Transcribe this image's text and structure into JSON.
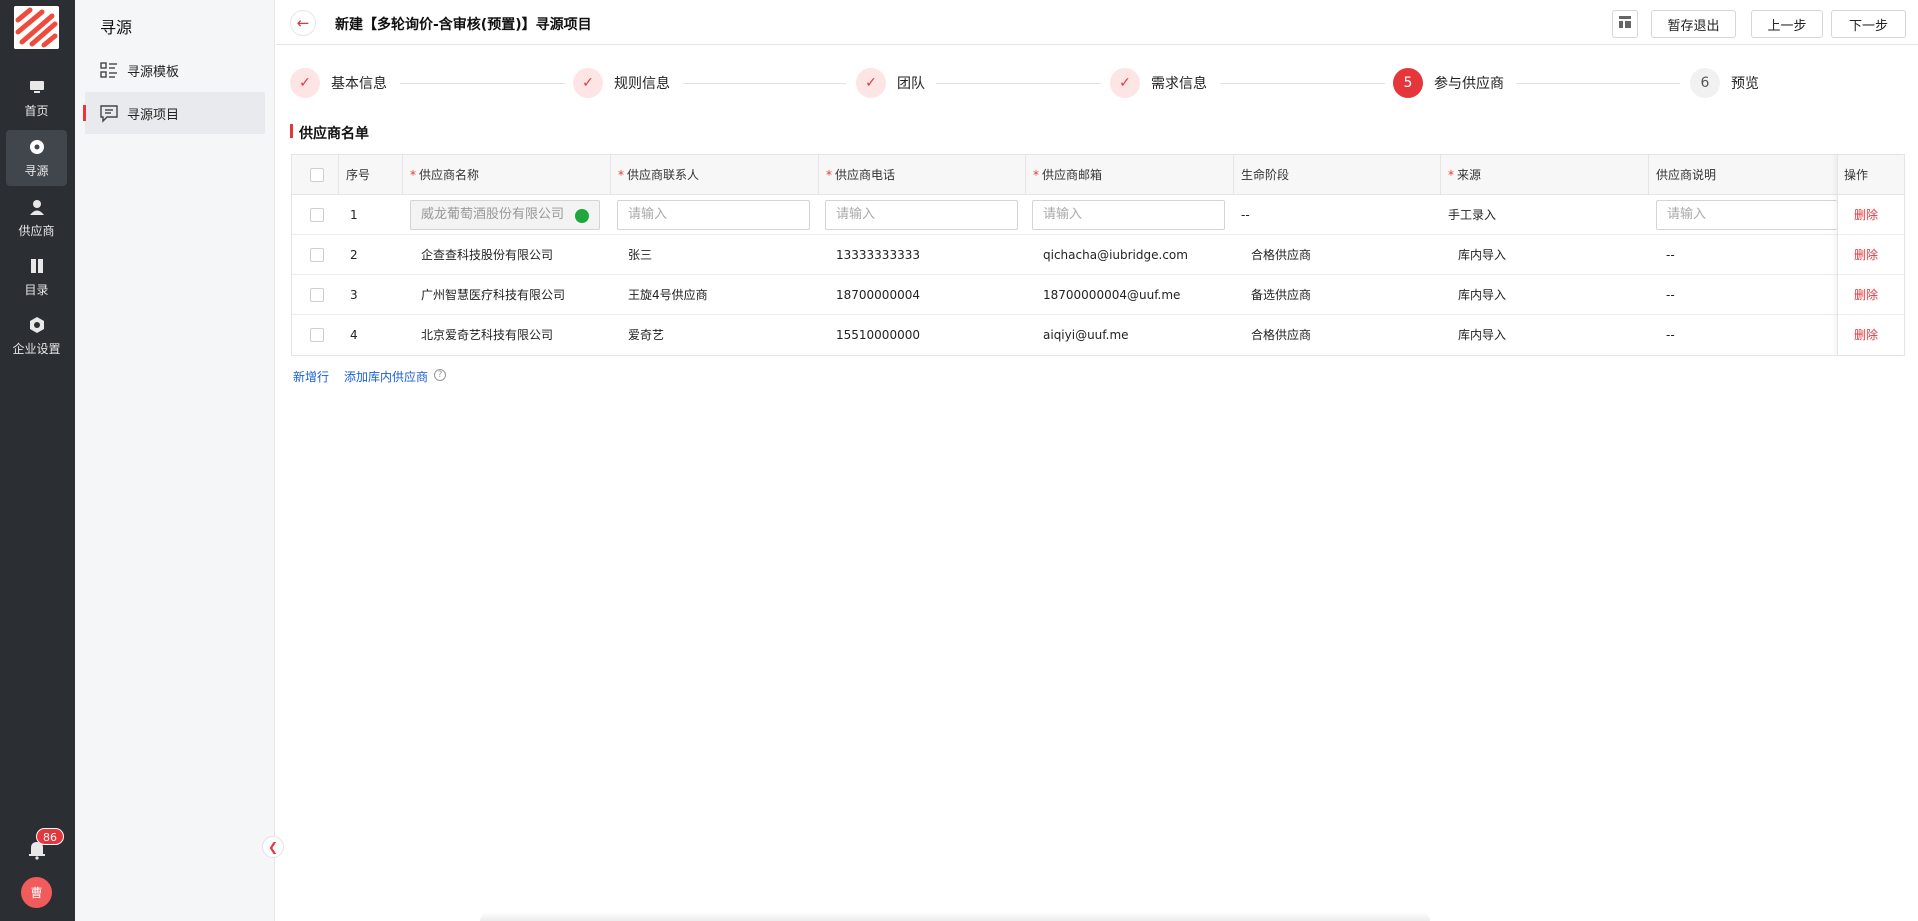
{
  "rail": {
    "items": [
      {
        "label": "首页",
        "icon": "monitor-icon"
      },
      {
        "label": "寻源",
        "icon": "compass-icon"
      },
      {
        "label": "供应商",
        "icon": "user-icon"
      },
      {
        "label": "目录",
        "icon": "book-icon"
      },
      {
        "label": "企业设置",
        "icon": "gear-icon"
      }
    ],
    "notification_count": "86",
    "avatar_text": "曹"
  },
  "sidebar": {
    "title": "寻源",
    "items": [
      {
        "label": "寻源模板",
        "icon": "template-list-icon"
      },
      {
        "label": "寻源项目",
        "icon": "chat-list-icon"
      }
    ]
  },
  "header": {
    "title": "新建【多轮询价-含审核(预置)】寻源项目",
    "save_exit": "暂存退出",
    "prev": "上一步",
    "next": "下一步"
  },
  "steps": [
    {
      "label": "基本信息",
      "status": "done",
      "num": ""
    },
    {
      "label": "规则信息",
      "status": "done",
      "num": ""
    },
    {
      "label": "团队",
      "status": "done",
      "num": ""
    },
    {
      "label": "需求信息",
      "status": "done",
      "num": ""
    },
    {
      "label": "参与供应商",
      "status": "current",
      "num": "5"
    },
    {
      "label": "预览",
      "status": "todo",
      "num": "6"
    }
  ],
  "section": {
    "title": "供应商名单"
  },
  "table": {
    "columns": [
      "序号",
      "供应商名称",
      "供应商联系人",
      "供应商电话",
      "供应商邮箱",
      "生命阶段",
      "来源",
      "供应商说明",
      "操作"
    ],
    "placeholder": "请输入",
    "rows": [
      {
        "index": "1",
        "name": "威龙葡萄酒股份有限公司",
        "contact": "",
        "phone": "",
        "email": "",
        "stage": "--",
        "source": "手工录入",
        "note": "",
        "action": "删除"
      },
      {
        "index": "2",
        "name": "企查查科技股份有限公司",
        "contact": "张三",
        "phone": "13333333333",
        "email": "qichacha@iubridge.com",
        "stage": "合格供应商",
        "source": "库内导入",
        "note": "--",
        "action": "删除"
      },
      {
        "index": "3",
        "name": "广州智慧医疗科技有限公司",
        "contact": "王旋4号供应商",
        "phone": "18700000004",
        "email": "18700000004@uuf.me",
        "stage": "备选供应商",
        "source": "库内导入",
        "note": "--",
        "action": "删除"
      },
      {
        "index": "4",
        "name": "北京爱奇艺科技有限公司",
        "contact": "爱奇艺",
        "phone": "15510000000",
        "email": "aiqiyi@uuf.me",
        "stage": "合格供应商",
        "source": "库内导入",
        "note": "--",
        "action": "删除"
      }
    ]
  },
  "actions": {
    "add_row": "新增行",
    "add_from_library": "添加库内供应商"
  },
  "colors": {
    "accent": "#e5363b",
    "link": "#1a5fd6",
    "rail_bg": "#2b2e33"
  }
}
